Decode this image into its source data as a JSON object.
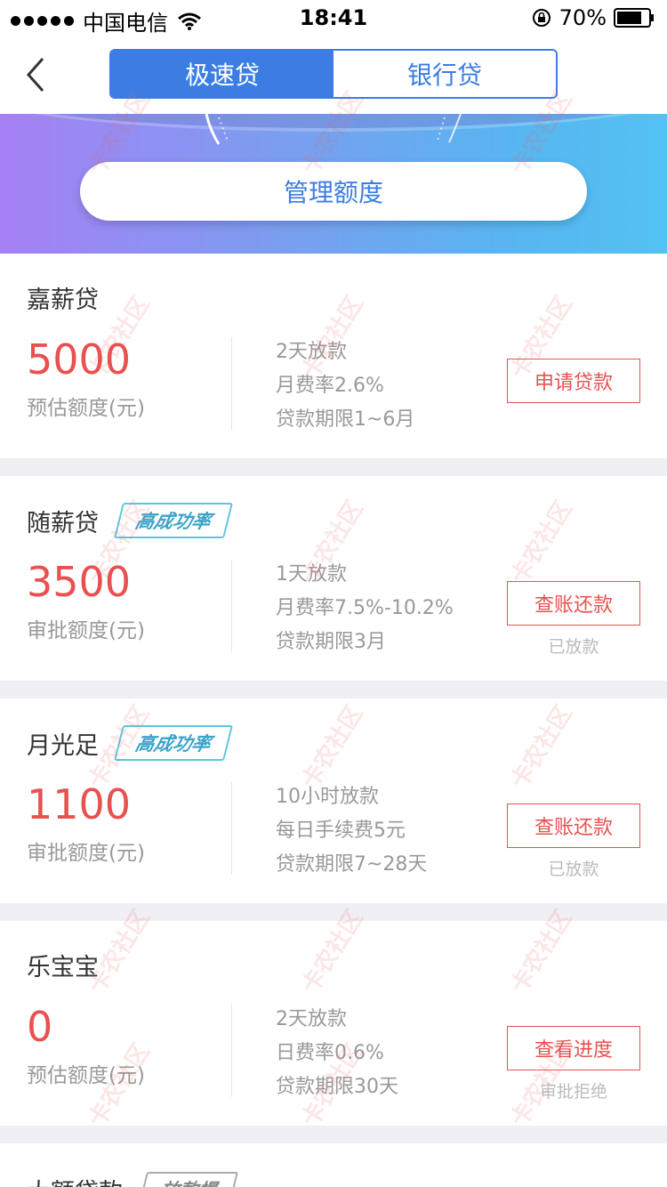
{
  "status_bar": {
    "carrier": "中国电信",
    "time": "18:41",
    "battery": "70%"
  },
  "nav": {
    "tabs": [
      "极速贷",
      "银行贷"
    ]
  },
  "banner": {
    "manage_label": "管理额度"
  },
  "loans": [
    {
      "name": "嘉薪贷",
      "badge": "",
      "amount": "5000",
      "amount_label": "预估额度(元)",
      "info": [
        "2天放款",
        "月费率2.6%",
        "贷款期限1~6月"
      ],
      "action": "申请贷款",
      "status": ""
    },
    {
      "name": "随薪贷",
      "badge": "高成功率",
      "amount": "3500",
      "amount_label": "审批额度(元)",
      "info": [
        "1天放款",
        "月费率7.5%-10.2%",
        "贷款期限3月"
      ],
      "action": "查账还款",
      "status": "已放款"
    },
    {
      "name": "月光足",
      "badge": "高成功率",
      "amount": "1100",
      "amount_label": "审批额度(元)",
      "info": [
        "10小时放款",
        "每日手续费5元",
        "贷款期限7~28天"
      ],
      "action": "查账还款",
      "status": "已放款"
    },
    {
      "name": "乐宝宝",
      "badge": "",
      "amount": "0",
      "amount_label": "预估额度(元)",
      "info": [
        "2天放款",
        "日费率0.6%",
        "贷款期限30天"
      ],
      "action": "查看进度",
      "status": "审批拒绝"
    },
    {
      "name": "大额贷款",
      "badge": "放款慢",
      "amount": "",
      "amount_label": "",
      "info": [],
      "action": "",
      "status": ""
    }
  ],
  "watermark": "卡农社区"
}
